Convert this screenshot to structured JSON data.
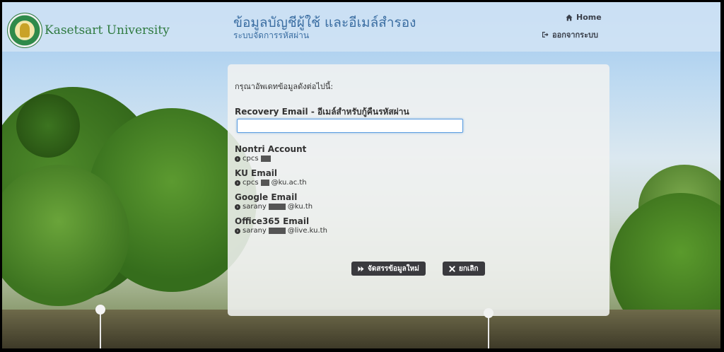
{
  "header": {
    "brand": "Kasetsart University",
    "title": "ข้อมูลบัญชีผู้ใช้ และอีเมล์สำรอง",
    "subtitle": "ระบบจัดการรหัสผ่าน",
    "nav": {
      "home": "Home",
      "logout": "ออกจากระบบ"
    }
  },
  "form": {
    "prompt": "กรุณาอัพเดทข้อมูลดังต่อไปนี้:",
    "recovery_label": "Recovery Email - อีเมล์สำหรับกู้คืนรหัสผ่าน",
    "recovery_value": "",
    "accounts": [
      {
        "label": "Nontri Account",
        "value_prefix": "cpcs",
        "value_suffix": ""
      },
      {
        "label": "KU Email",
        "value_prefix": "cpcs",
        "value_suffix": "@ku.ac.th"
      },
      {
        "label": "Google Email",
        "value_prefix": "sarany",
        "value_suffix": "@ku.th"
      },
      {
        "label": "Office365 Email",
        "value_prefix": "sarany",
        "value_suffix": "@live.ku.th"
      }
    ],
    "save_label": "จัดสรรข้อมูลใหม่",
    "cancel_label": "ยกเลิก"
  },
  "colors": {
    "brand_green": "#2f7a40",
    "title_blue": "#3b6ea2",
    "button_dark": "#3a3a3e",
    "input_focus": "#5b9ce0"
  },
  "icons": {
    "home": "home-icon",
    "logout": "sign-out-icon",
    "bullet": "chevron-circle-right-icon",
    "save": "forward-icon",
    "cancel": "close-icon"
  }
}
